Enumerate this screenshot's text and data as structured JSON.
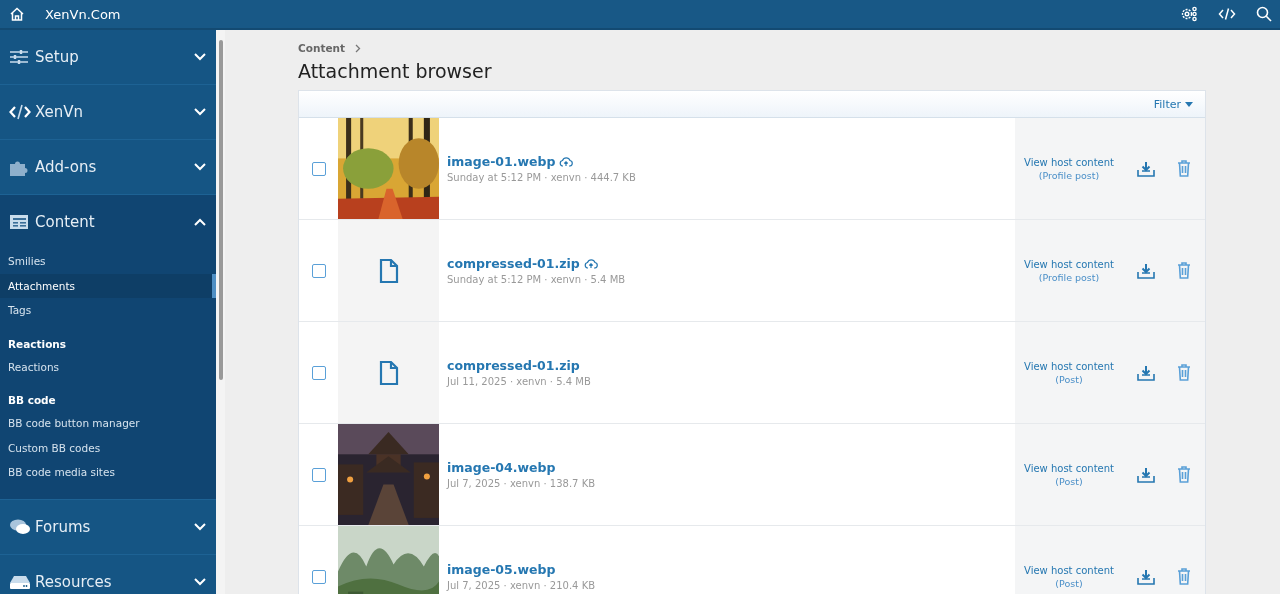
{
  "header": {
    "title": "XenVn.Com"
  },
  "sidebar": {
    "sections": [
      {
        "label": "Setup",
        "expanded": false
      },
      {
        "label": "XenVn",
        "expanded": false
      },
      {
        "label": "Add-ons",
        "expanded": false
      },
      {
        "label": "Content",
        "expanded": true,
        "items": [
          {
            "kind": "link",
            "label": "Smilies",
            "selected": false
          },
          {
            "kind": "link",
            "label": "Attachments",
            "selected": true
          },
          {
            "kind": "link",
            "label": "Tags",
            "selected": false
          },
          {
            "kind": "heading",
            "label": "Reactions"
          },
          {
            "kind": "link",
            "label": "Reactions",
            "selected": false
          },
          {
            "kind": "heading",
            "label": "BB code"
          },
          {
            "kind": "link",
            "label": "BB code button manager",
            "selected": false
          },
          {
            "kind": "link",
            "label": "Custom BB codes",
            "selected": false
          },
          {
            "kind": "link",
            "label": "BB code media sites",
            "selected": false
          }
        ]
      },
      {
        "label": "Forums",
        "expanded": false
      },
      {
        "label": "Resources",
        "expanded": false
      }
    ]
  },
  "breadcrumb": [
    "Content"
  ],
  "page_title": "Attachment browser",
  "filter": {
    "label": "Filter"
  },
  "attachments": [
    {
      "name": "image-01.webp",
      "cloud_icon": true,
      "meta": "Sunday at 5:12 PM · xenvn · 444.7 KB",
      "host_link": "View host content",
      "host_type": "(Profile post)",
      "checked": false
    },
    {
      "kind": "file",
      "name": "compressed-01.zip",
      "cloud_icon": true,
      "meta": "Sunday at 5:12 PM · xenvn · 5.4 MB",
      "host_link": "View host content",
      "host_type": "(Profile post)",
      "checked": false
    },
    {
      "kind": "file",
      "name": "compressed-01.zip",
      "cloud_icon": false,
      "meta": "Jul 11, 2025 · xenvn · 5.4 MB",
      "host_link": "View host content",
      "host_type": "(Post)",
      "checked": false
    },
    {
      "name": "image-04.webp",
      "cloud_icon": false,
      "meta": "Jul 7, 2025 · xenvn · 138.7 KB",
      "host_link": "View host content",
      "host_type": "(Post)",
      "checked": false
    },
    {
      "name": "image-05.webp",
      "cloud_icon": false,
      "meta": "Jul 7, 2025 · xenvn · 210.4 KB",
      "host_link": "View host content",
      "host_type": "(Post)",
      "checked": false
    }
  ]
}
